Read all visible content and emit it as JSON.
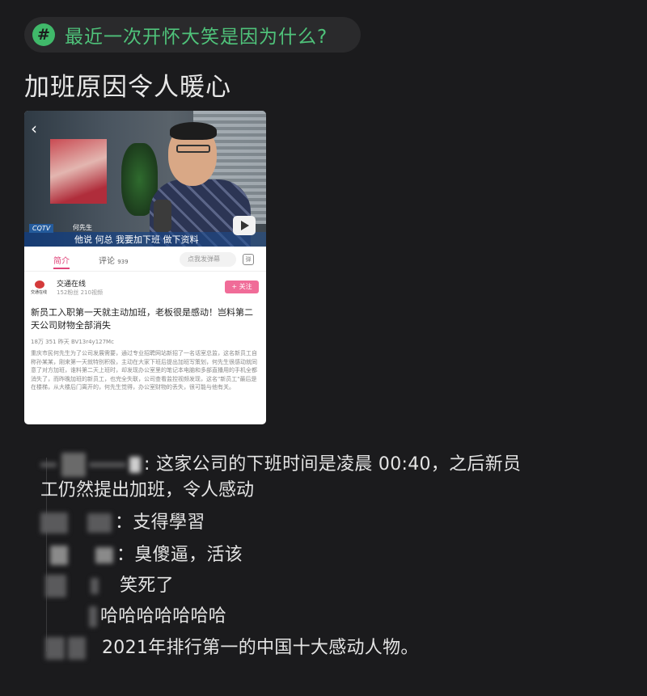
{
  "topic": {
    "icon": "hash-icon",
    "text": "最近一次开怀大笑是因为什么?",
    "color": "#4fc27a"
  },
  "post_title": "加班原因令人暖心",
  "screenshot": {
    "video": {
      "station_label": "CQTV",
      "speaker_name": "何先生",
      "caption": "他说 何总 我要加下班 做下资料",
      "back_icon": "chevron-left-icon",
      "tv_icon": "tv-play-icon"
    },
    "tabs": {
      "intro": "简介",
      "comments": "评论",
      "comments_count": "939",
      "danmaku_placeholder": "点我发弹幕"
    },
    "uploader": {
      "logo_text": "交通在线",
      "name": "交通在线",
      "stats": "152粉丝  210视频",
      "follow": "+ 关注"
    },
    "video_title": "新员工入职第一天就主动加班，老板很是感动！岂料第二天公司财物全部消失",
    "meta": "18万    351    昨天    BV13r4y127Mc",
    "description": "重庆市民何先生为了公司发展需要，通过专业招聘网站新招了一名话室总监，这名新员工自称孙某某，刚来第一天就特别积极，主动在大家下班后提出加班写策划，何先生很感动就同意了对方加班，谁料第二天上班时，却发现办公室里的笔记本电脑和多部直播用的手机全都消失了，而昨晚加班的新员工，也完全失联，公司查看监控视频发现，这名\"新员工\"最后是在楼梯，从大楼后门离开的，何先生觉得，办公室财物的丢失，很可能与他有关。"
  },
  "comments": [
    {
      "text": ": 这家公司的下班时间是凌晨 00:40，之后新员",
      "continuation": "工仍然提出加班，令人感动"
    },
    {
      "text": "：支得學習"
    },
    {
      "text": "：臭傻逼，活该"
    },
    {
      "text": "笑死了"
    },
    {
      "text": "哈哈哈哈哈哈哈"
    },
    {
      "text": "2021年排行第一的中国十大感动人物。"
    }
  ]
}
